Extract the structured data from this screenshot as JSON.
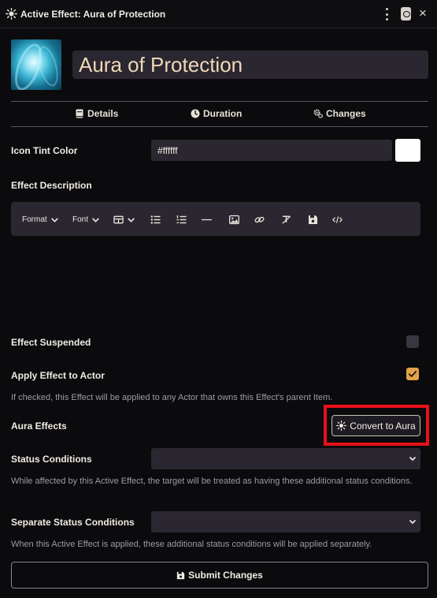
{
  "window": {
    "title": "Active Effect: Aura of Protection",
    "close_glyph": "×"
  },
  "header": {
    "name": "Aura of Protection"
  },
  "tabs": [
    {
      "label": "Details",
      "icon": "book-icon"
    },
    {
      "label": "Duration",
      "icon": "clock-icon"
    },
    {
      "label": "Changes",
      "icon": "cogs-icon"
    }
  ],
  "details": {
    "icon_tint": {
      "label": "Icon Tint Color",
      "value": "#ffffff",
      "swatch_color": "#ffffff"
    },
    "description": {
      "label": "Effect Description"
    },
    "editor_tools": {
      "format": "Format",
      "font": "Font"
    },
    "suspended": {
      "label": "Effect Suspended",
      "checked": false
    },
    "apply_to_actor": {
      "label": "Apply Effect to Actor",
      "checked": true,
      "hint": "If checked, this Effect will be applied to any Actor that owns this Effect's parent Item."
    },
    "aura": {
      "label": "Aura Effects",
      "button": "Convert to Aura"
    },
    "status_conditions": {
      "label": "Status Conditions",
      "value": "",
      "hint": "While affected by this Active Effect, the target will be treated as having these additional status conditions."
    },
    "separate_status": {
      "label": "Separate Status Conditions",
      "value": "",
      "hint": "When this Active Effect is applied, these additional status conditions will be applied separately."
    }
  },
  "footer": {
    "submit": "Submit Changes"
  },
  "colors": {
    "accent": "#e3a34a",
    "highlight": "#e8111a",
    "background": "#0b0a0c",
    "field": "#2b2730"
  }
}
